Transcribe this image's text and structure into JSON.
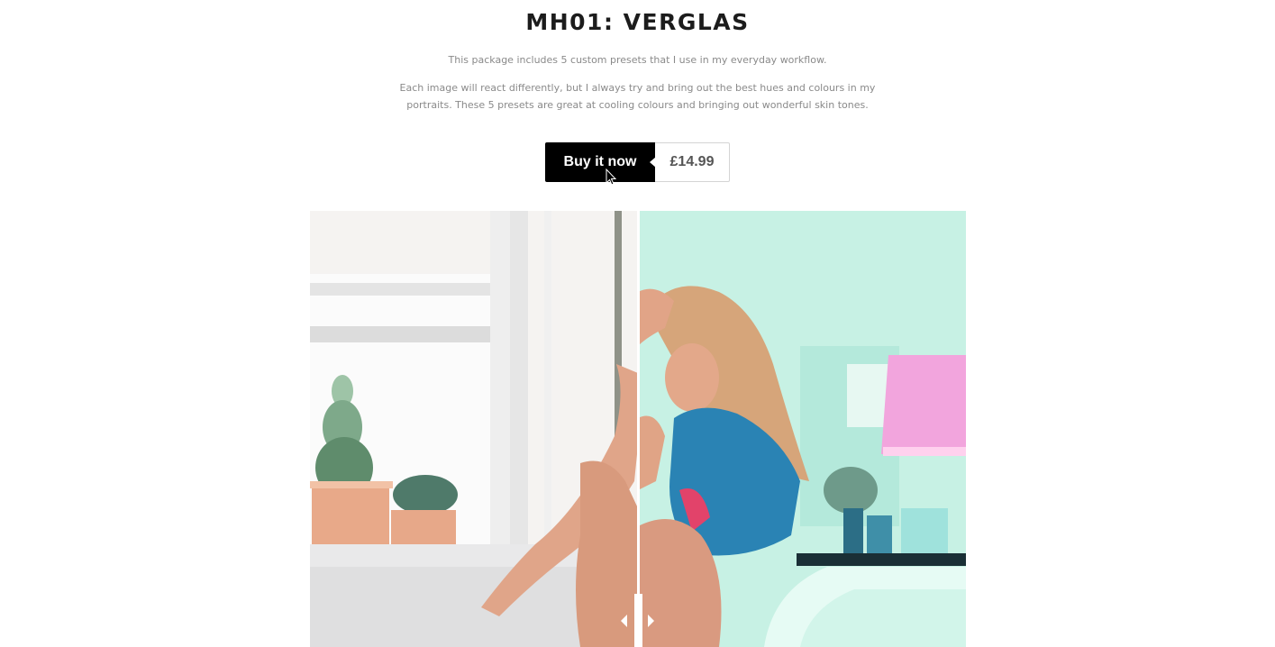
{
  "product": {
    "title": "MH01: VERGLAS",
    "description_1": "This package includes 5 custom presets that I use in my everyday workflow.",
    "description_2": "Each image will react differently, but I always try and bring out the best hues and colours in my portraits. These 5 presets are great at cooling colours and bringing out wonderful skin tones."
  },
  "purchase": {
    "buy_label": "Buy it now",
    "price": "£14.99"
  },
  "comparison": {
    "before_icon": "before-photo",
    "after_icon": "after-photo",
    "slider_position": 0.5
  },
  "colors": {
    "button_bg": "#000000",
    "after_tint": "#c9f2e6"
  }
}
